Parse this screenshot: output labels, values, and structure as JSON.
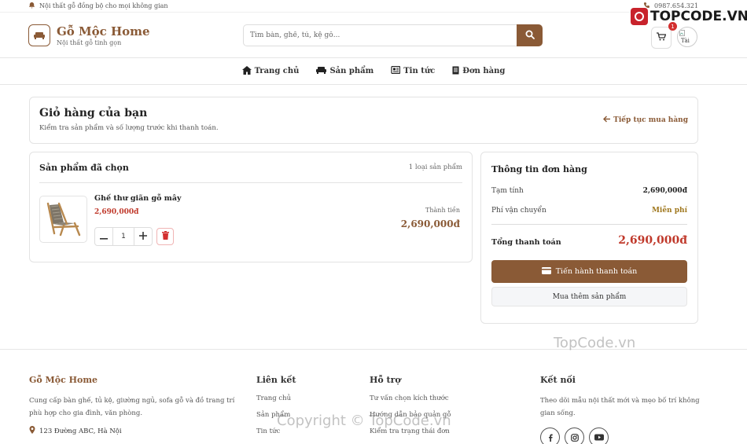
{
  "topbar": {
    "tagline": "Nội thất gỗ đồng bộ cho mọi không gian",
    "phone": "0987.654.321"
  },
  "brand_watermark": "TOPCODE.VN",
  "header": {
    "logo_title": "Gỗ Mộc Home",
    "logo_subtitle": "Nội thất gỗ tinh gọn",
    "search_placeholder": "Tìm bàn, ghế, tủ, kệ gỗ...",
    "cart_count": "1",
    "avatar_alt": "Tài"
  },
  "nav": [
    {
      "label": "Trang chủ",
      "icon": "home-icon"
    },
    {
      "label": "Sản phẩm",
      "icon": "sofa-icon"
    },
    {
      "label": "Tin tức",
      "icon": "newspaper-icon"
    },
    {
      "label": "Đơn hàng",
      "icon": "receipt-icon"
    }
  ],
  "page": {
    "title": "Giỏ hàng của bạn",
    "subtitle": "Kiểm tra sản phẩm và số lượng trước khi thanh toán.",
    "continue_label": "Tiếp tục mua hàng"
  },
  "cart": {
    "heading": "Sản phẩm đã chọn",
    "count_label": "1 loại sản phẩm",
    "items": [
      {
        "name": "Ghế thư giãn gỗ mây",
        "price": "2,690,000đ",
        "quantity": "1",
        "subtotal_label": "Thành tiền",
        "subtotal": "2,690,000đ"
      }
    ]
  },
  "summary": {
    "heading": "Thông tin đơn hàng",
    "subtotal_label": "Tạm tính",
    "subtotal_value": "2,690,000đ",
    "shipping_label": "Phí vận chuyển",
    "shipping_value": "Miễn phí",
    "total_label": "Tổng thanh toán",
    "total_value": "2,690,000đ",
    "checkout_label": "Tiến hành thanh toán",
    "more_label": "Mua thêm sản phẩm"
  },
  "footer": {
    "brand_title": "Gỗ Mộc Home",
    "brand_desc": "Cung cấp bàn ghế, tủ kệ, giường ngủ, sofa gỗ và đồ trang trí phù hợp cho gia đình, văn phòng.",
    "address": "123 Đường ABC, Hà Nội",
    "links_title": "Liên kết",
    "links": [
      "Trang chủ",
      "Sản phẩm",
      "Tin tức"
    ],
    "support_title": "Hỗ trợ",
    "support": [
      "Tư vấn chọn kích thước",
      "Hướng dẫn bảo quản gỗ",
      "Kiểm tra trạng thái đơn"
    ],
    "connect_title": "Kết nối",
    "connect_desc": "Theo dõi mẫu nội thất mới và mẹo bố trí không gian sống.",
    "socials": [
      "facebook-icon",
      "instagram-icon",
      "youtube-icon"
    ]
  },
  "watermarks": {
    "center": "TopCode.vn",
    "bottom": "Copyright © TopCode.vn"
  },
  "colors": {
    "accent": "#8a5a36",
    "price": "#c0392b",
    "free": "#a0781f"
  }
}
